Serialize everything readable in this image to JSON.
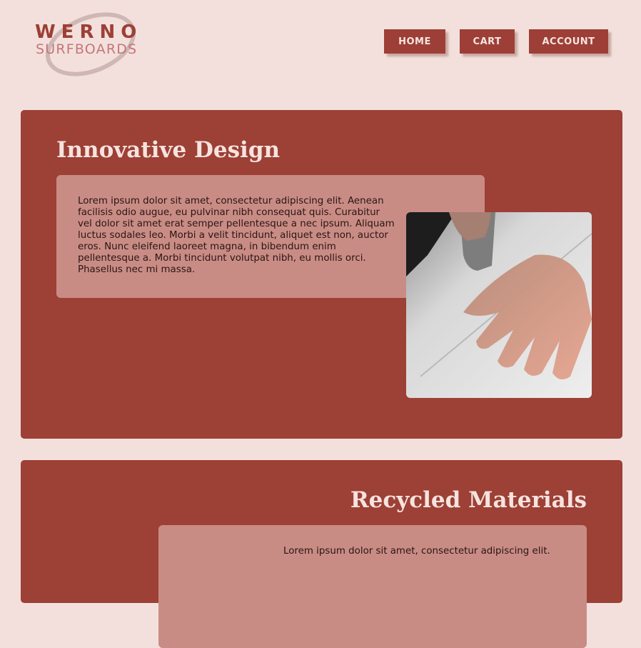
{
  "brand": {
    "line1": "WERNO",
    "line2": "SURFBOARDS"
  },
  "nav": {
    "home": "HOME",
    "cart": "CART",
    "account": "ACCOUNT"
  },
  "sections": [
    {
      "title": "Innovative Design",
      "body": "Lorem ipsum dolor sit amet, consectetur adipiscing elit. Aenean facilisis odio augue, eu pulvinar nibh consequat quis. Curabitur vel dolor sit amet erat semper pellentesque a nec ipsum. Aliquam luctus sodales leo. Morbi a velit tincidunt, aliquet est non, auctor eros. Nunc eleifend laoreet magna, in bibendum enim pellentesque a. Morbi tincidunt volutpat nibh, eu mollis orci. Phasellus nec mi massa."
    },
    {
      "title": "Recycled Materials",
      "body": "Lorem ipsum dolor sit amet, consectetur adipiscing elit."
    }
  ],
  "colors": {
    "background": "#f3e0dc",
    "accent": "#9d4036",
    "panel": "#c98c85",
    "heading": "#f6e3de"
  }
}
